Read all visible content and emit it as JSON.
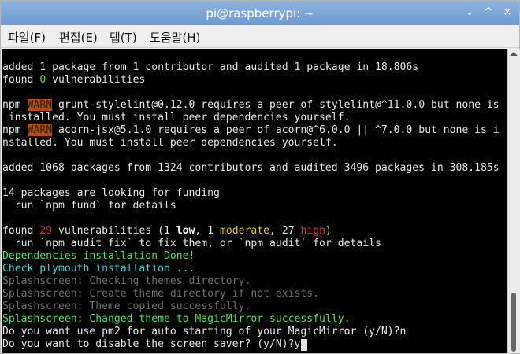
{
  "window": {
    "title": "pi@raspberrypi: ~",
    "controls": [
      "⌄",
      "^",
      "×"
    ]
  },
  "menu": [
    "파일(F)",
    "편집(E)",
    "탭(T)",
    "도움말(H)"
  ],
  "terminal": {
    "lines": [
      [
        {
          "t": "added 1 package from 1 contributor and audited 1 package in 18.806s"
        }
      ],
      [
        {
          "t": "found "
        },
        {
          "t": "0",
          "c": "green"
        },
        {
          "t": " vulnerabilities"
        }
      ],
      [
        {
          "t": ""
        }
      ],
      [
        {
          "t": "npm "
        },
        {
          "t": "WARN",
          "c": "warn"
        },
        {
          "t": " grunt-stylelint@0.12.0 requires a peer of stylelint@^11.0.0 but none is"
        }
      ],
      [
        {
          "t": " installed. You must install peer dependencies yourself."
        }
      ],
      [
        {
          "t": "npm "
        },
        {
          "t": "WARN",
          "c": "warn"
        },
        {
          "t": " acorn-jsx@5.1.0 requires a peer of acorn@^6.0.0 || ^7.0.0 but none is i"
        }
      ],
      [
        {
          "t": "nstalled. You must install peer dependencies yourself."
        }
      ],
      [
        {
          "t": ""
        }
      ],
      [
        {
          "t": "added 1068 packages from 1324 contributors and audited 3496 packages in 308.185s"
        }
      ],
      [
        {
          "t": ""
        }
      ],
      [
        {
          "t": "14 packages are looking for funding"
        }
      ],
      [
        {
          "t": "  run `npm fund` for details"
        }
      ],
      [
        {
          "t": ""
        }
      ],
      [
        {
          "t": "found "
        },
        {
          "t": "29",
          "c": "red"
        },
        {
          "t": " vulnerabilities (1 "
        },
        {
          "t": "low",
          "c": "bold"
        },
        {
          "t": ", 1 "
        },
        {
          "t": "moderate",
          "c": "yellow"
        },
        {
          "t": ", 27 "
        },
        {
          "t": "high",
          "c": "red"
        },
        {
          "t": ")"
        }
      ],
      [
        {
          "t": "  run `npm audit fix` to fix them, or `npm audit` for details"
        }
      ],
      [
        {
          "t": "Dependencies installation Done!",
          "c": "green"
        }
      ],
      [
        {
          "t": "Check plymouth installation ...",
          "c": "cyan"
        }
      ],
      [
        {
          "t": "Splashscreen: Checking themes directory.",
          "c": "dim"
        }
      ],
      [
        {
          "t": "Splashscreen: Create theme directory if not exists.",
          "c": "dim"
        }
      ],
      [
        {
          "t": "Splashscreen: Theme copied successfully.",
          "c": "dim"
        }
      ],
      [
        {
          "t": "Splashscreen: Changed theme to MagicMirror successfully.",
          "c": "green"
        }
      ],
      [
        {
          "t": "Do you want use pm2 for auto starting of your MagicMirror (y/N)?n"
        }
      ],
      [
        {
          "t": "Do you want to disable the screen saver? (y/N)?y"
        }
      ]
    ]
  }
}
